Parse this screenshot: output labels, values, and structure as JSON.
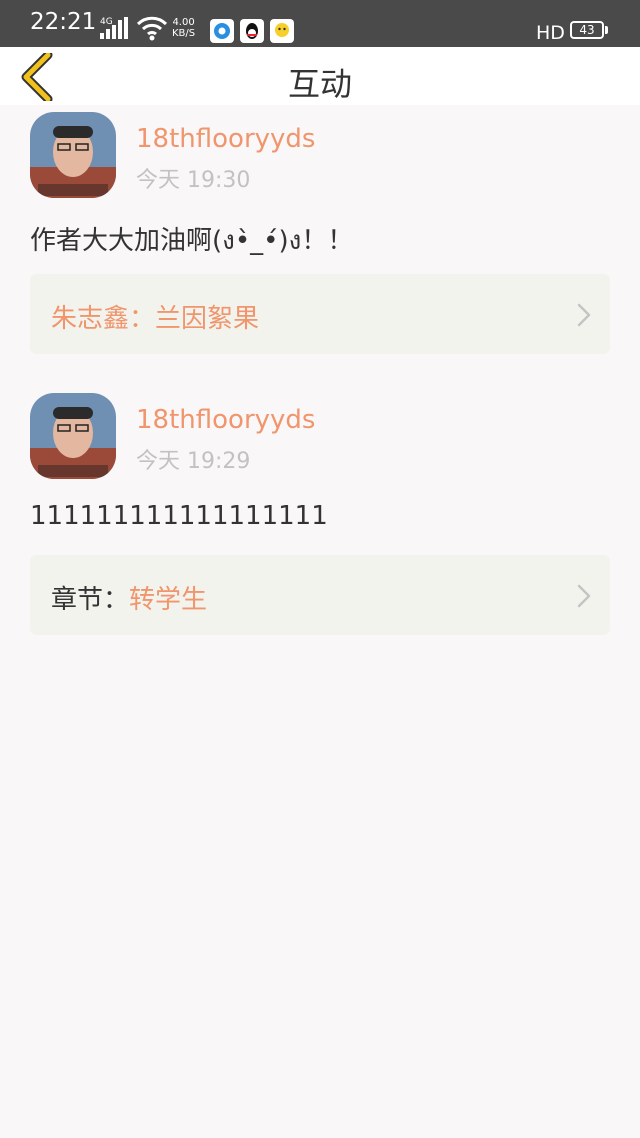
{
  "status_bar": {
    "time": "22:21",
    "network": "4G",
    "speed_value": "4.00",
    "speed_unit": "KB/S",
    "hd": "HD",
    "battery": "43"
  },
  "header": {
    "title": "互动"
  },
  "comments": [
    {
      "username": "18thflooryyds",
      "time": "今天 19:30",
      "content": "作者大大加油啊(ง•̀_•́)ง！！",
      "ref_prefix": "朱志鑫：",
      "ref_value": "兰因絮果"
    },
    {
      "username": "18thflooryyds",
      "time": "今天 19:29",
      "content": "111111111111111111",
      "ref_prefix": "章节：",
      "ref_value": "转学生"
    }
  ],
  "colors": {
    "accent": "#f0956c",
    "back_icon": "#f2c21c",
    "background": "#f9f7f8"
  }
}
